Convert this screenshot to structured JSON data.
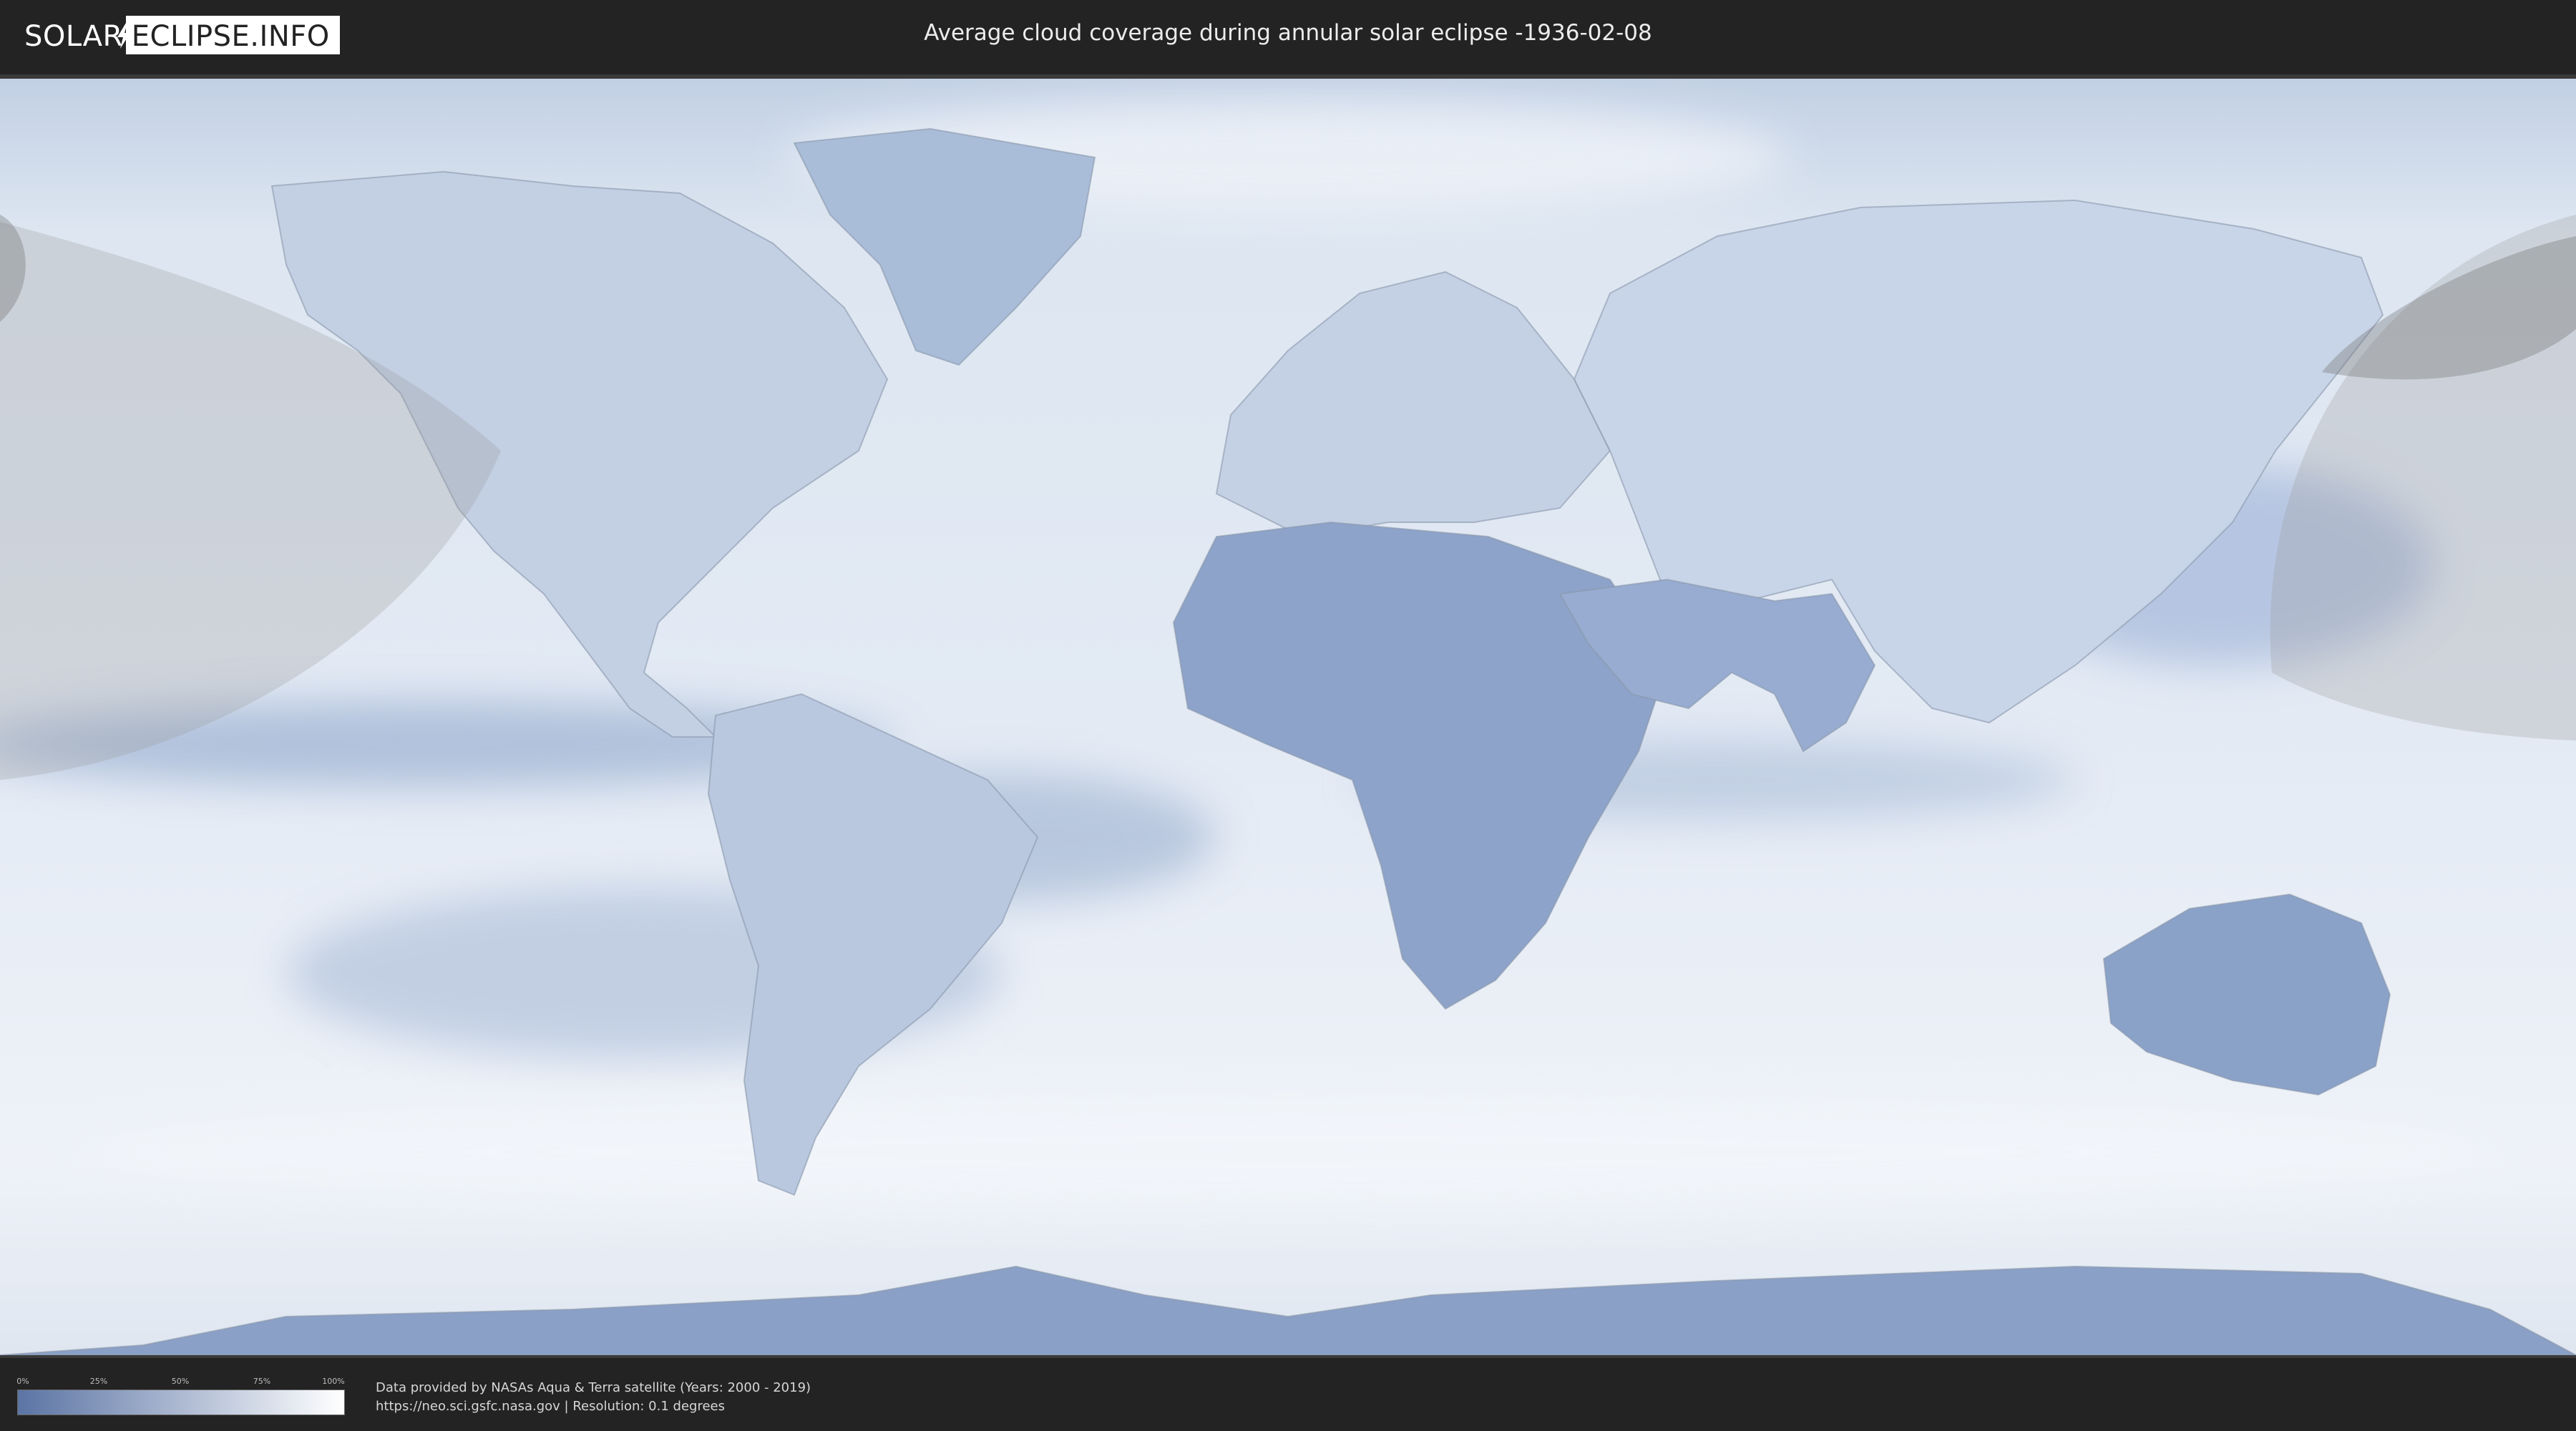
{
  "header": {
    "logo_left": "SOLAR",
    "logo_right": "ECLIPSE.INFO",
    "title": "Average cloud coverage during annular solar eclipse -1936-02-08"
  },
  "legend": {
    "ticks": [
      "0%",
      "25%",
      "50%",
      "75%",
      "100%"
    ],
    "tick_values": [
      0,
      25,
      50,
      75,
      100
    ],
    "color_low": "#5b74a4",
    "color_high": "#ffffff"
  },
  "footer": {
    "credit_line1": "Data provided by NASAs Aqua & Terra satellite (Years: 2000 - 2019)",
    "credit_line2": "https://neo.sci.gsfc.nasa.gov | Resolution: 0.1 degrees"
  },
  "map": {
    "projection": "equirectangular",
    "ocean_color": "#dfe8f3",
    "cloud_low_color": "#6f88b5",
    "shadow_color": "#9a9a9a"
  }
}
